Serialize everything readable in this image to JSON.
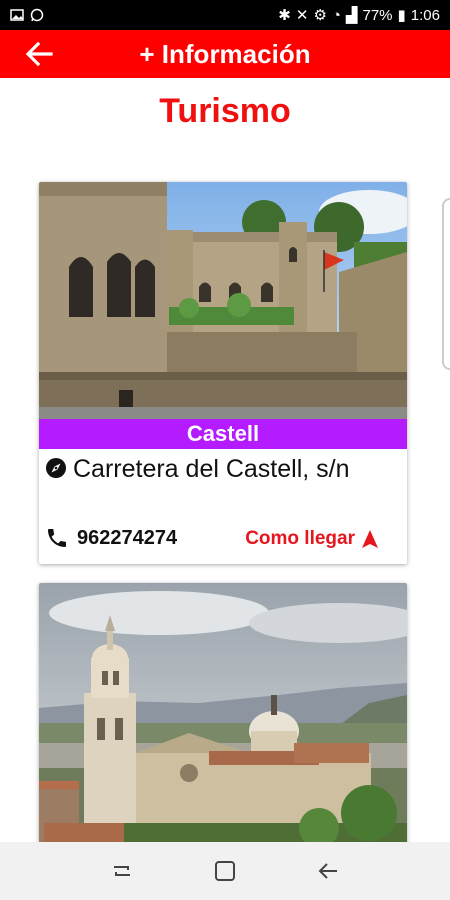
{
  "status_bar": {
    "battery": "77%",
    "time": "1:06"
  },
  "app_bar": {
    "title": "+ Información"
  },
  "page": {
    "title": "Turismo"
  },
  "places": [
    {
      "name": "Castell",
      "address": "Carretera del Castell, s/n",
      "phone": "962274274",
      "route_label": "Como llegar"
    }
  ],
  "colors": {
    "app_bar": "#ff0000",
    "title": "#f01010",
    "name_band": "#b41bff",
    "route": "#e5161e"
  },
  "icons": {
    "back": "arrow-left-icon",
    "address": "compass-icon",
    "phone": "phone-icon",
    "route": "navigation-arrow-icon"
  }
}
